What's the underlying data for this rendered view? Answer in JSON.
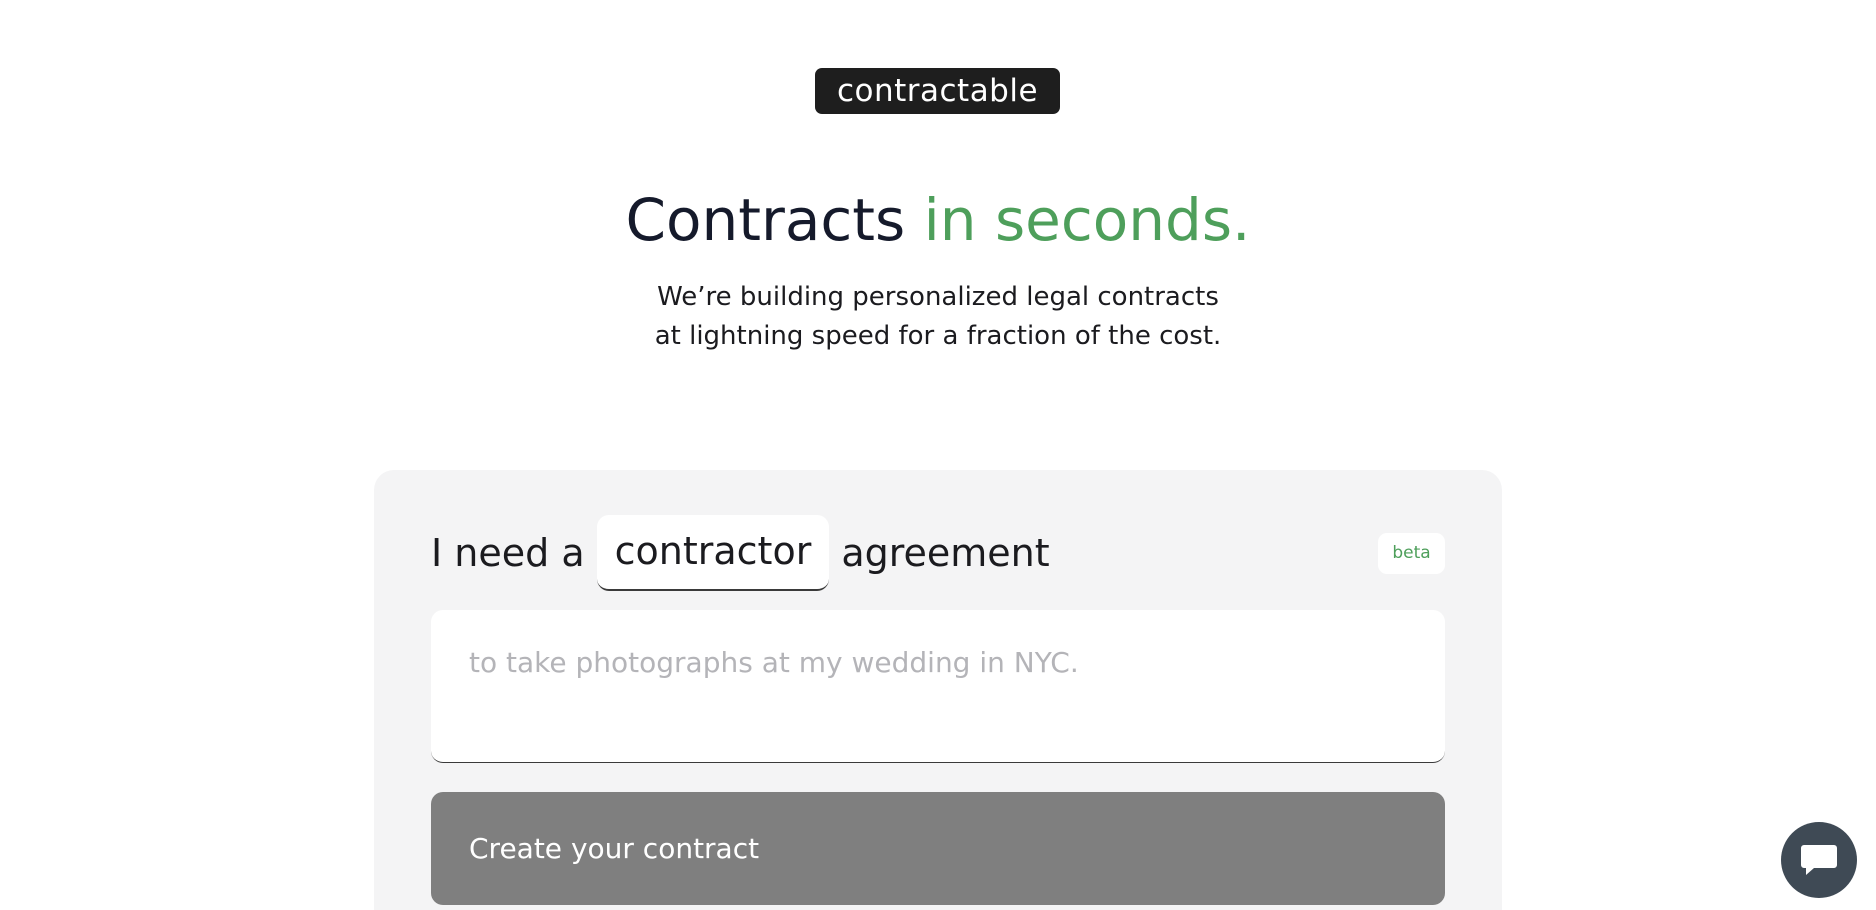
{
  "logo": {
    "text": "contractable"
  },
  "hero": {
    "headline_main": "Contracts ",
    "headline_accent": "in seconds.",
    "subhead_line1": "We’re building personalized legal contracts",
    "subhead_line2": "at lightning speed for a fraction of the cost."
  },
  "form": {
    "prefix": "I need a",
    "contract_type": "contractor",
    "suffix": "agreement",
    "badge": "beta",
    "description_placeholder": "to take photographs at my wedding in NYC.",
    "description_value": "",
    "submit_label": "Create your contract"
  },
  "chat": {
    "icon": "chat-bubble-icon"
  },
  "colors": {
    "accent": "#4e9f5b",
    "logo_bg": "#1e1e1e",
    "card_bg": "#f4f4f5",
    "button_bg": "#7f7f7f",
    "chat_bg": "#3f4a55"
  }
}
